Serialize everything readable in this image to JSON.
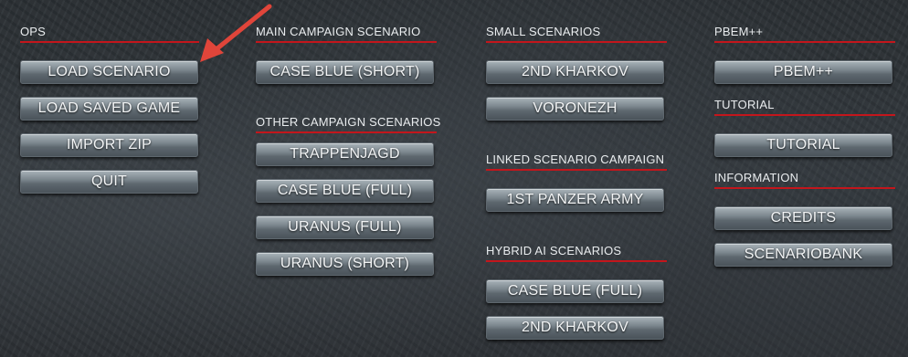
{
  "ops": {
    "heading": "OPS",
    "buttons": [
      "LOAD SCENARIO",
      "LOAD SAVED GAME",
      "IMPORT ZIP",
      "QUIT"
    ]
  },
  "main_campaign": {
    "heading": "MAIN CAMPAIGN SCENARIO",
    "buttons": [
      "CASE BLUE (SHORT)"
    ]
  },
  "other_campaign": {
    "heading": "OTHER CAMPAIGN SCENARIOS",
    "buttons": [
      "TRAPPENJAGD",
      "CASE BLUE (FULL)",
      "URANUS (FULL)",
      "URANUS (SHORT)"
    ]
  },
  "small_scenarios": {
    "heading": "SMALL SCENARIOS",
    "buttons": [
      "2ND KHARKOV",
      "VORONEZH"
    ]
  },
  "linked_campaign": {
    "heading": "LINKED SCENARIO CAMPAIGN",
    "buttons": [
      "1ST PANZER ARMY"
    ]
  },
  "hybrid_ai": {
    "heading": "HYBRID AI SCENARIOS",
    "buttons": [
      "CASE BLUE (FULL)",
      "2ND KHARKOV"
    ]
  },
  "pbem": {
    "heading": "PBEM++",
    "buttons": [
      "PBEM++"
    ]
  },
  "tutorial": {
    "heading": "TUTORIAL",
    "buttons": [
      "TUTORIAL"
    ]
  },
  "information": {
    "heading": "INFORMATION",
    "buttons": [
      "CREDITS",
      "SCENARIOBANK"
    ]
  },
  "colors": {
    "underline": "#c3161c",
    "annotation_arrow": "#e0453a"
  },
  "annotation": {
    "arrow_icon": "red-arrow-icon",
    "points_to": "LOAD SCENARIO"
  }
}
